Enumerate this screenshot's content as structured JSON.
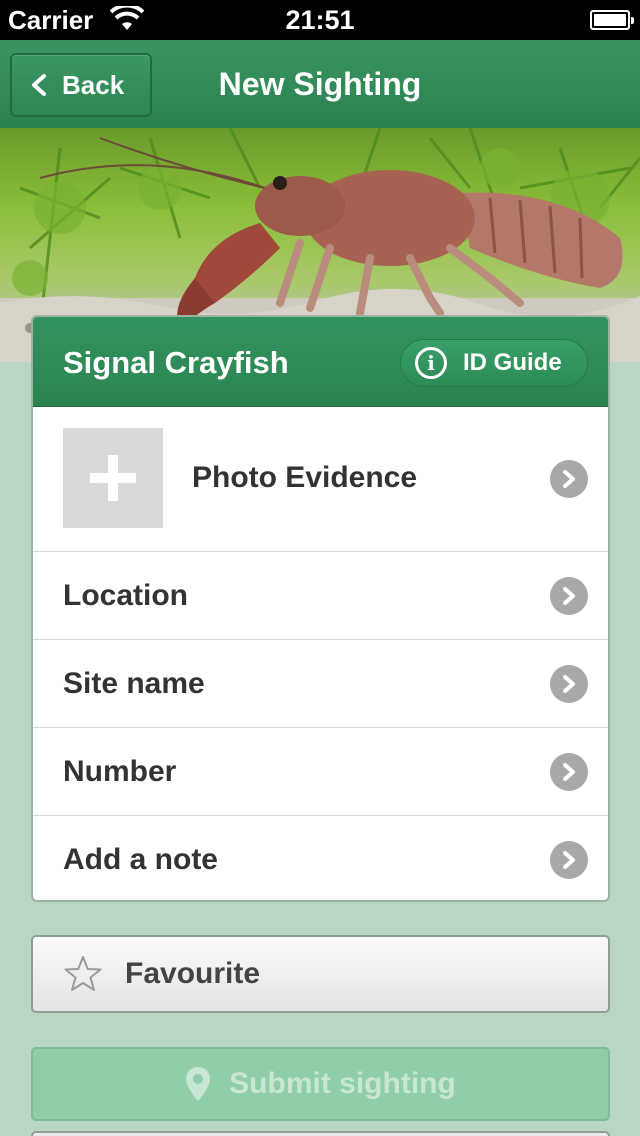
{
  "status_bar": {
    "carrier": "Carrier",
    "time": "21:51",
    "wifi_icon": "wifi-icon",
    "battery_icon": "battery-icon"
  },
  "nav": {
    "back_label": "Back",
    "title": "New Sighting"
  },
  "hero": {
    "image": "crayfish-photo"
  },
  "card": {
    "species": "Signal Crayfish",
    "id_guide_label": "ID Guide",
    "rows": [
      {
        "label": "Photo Evidence"
      },
      {
        "label": "Location"
      },
      {
        "label": "Site name"
      },
      {
        "label": "Number"
      },
      {
        "label": "Add a note"
      }
    ]
  },
  "favourite_label": "Favourite",
  "submit_label": "Submit sighting",
  "colors": {
    "nav_green": "#2e8b57",
    "background": "#b9d5c3",
    "submit_disabled": "#8fcea8"
  }
}
